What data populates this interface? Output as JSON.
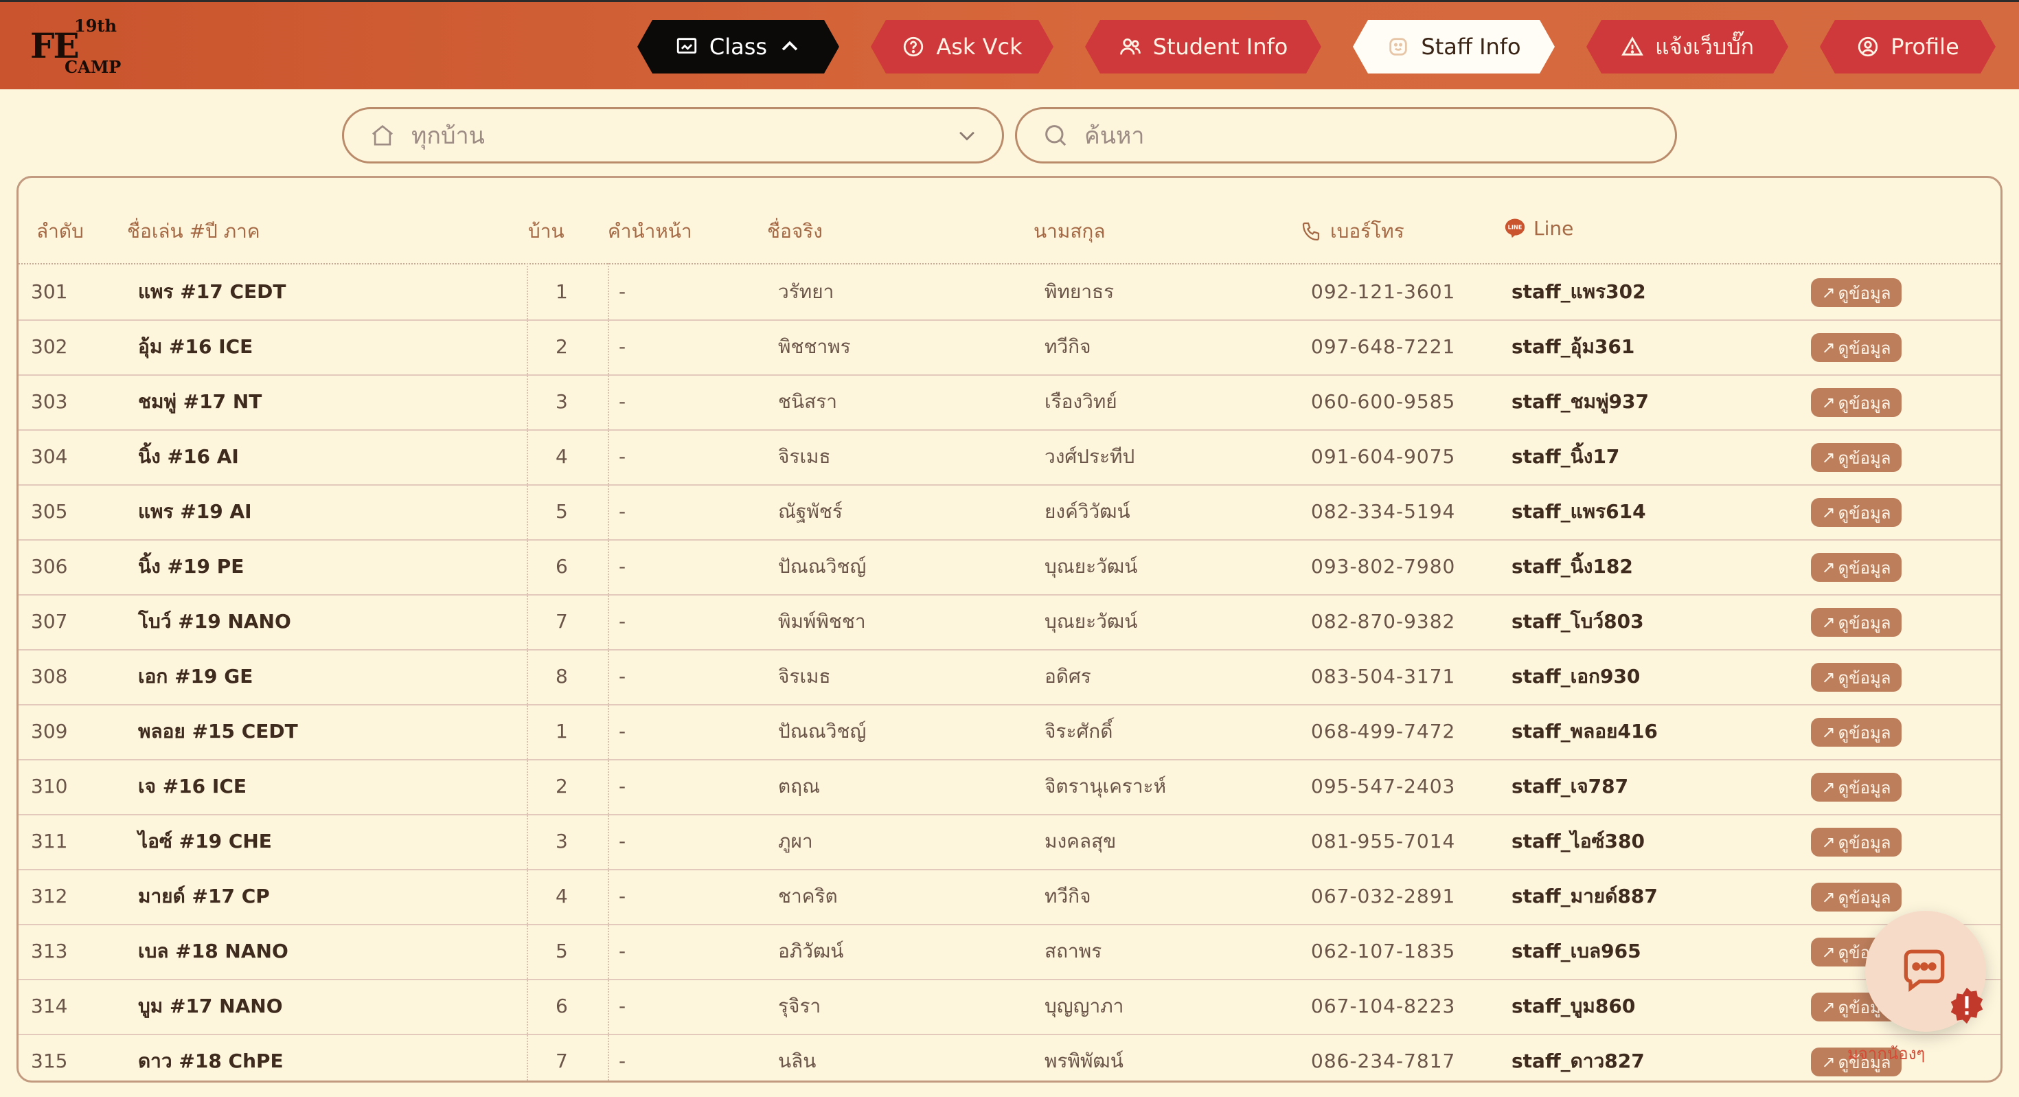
{
  "logo": {
    "main": "FE",
    "superscript": "19th",
    "sub": "CAMP"
  },
  "nav": [
    {
      "label": "Class",
      "icon": "presentation-icon",
      "style": "dark"
    },
    {
      "label": "Ask Vck",
      "icon": "question-icon",
      "style": "red"
    },
    {
      "label": "Student Info",
      "icon": "users-icon",
      "style": "red"
    },
    {
      "label": "Staff Info",
      "icon": "smiley-icon",
      "style": "active"
    },
    {
      "label": "แจ้งเว็บบั๊ก",
      "icon": "warning-icon",
      "style": "red"
    },
    {
      "label": "Profile",
      "icon": "user-circle-icon",
      "style": "red"
    }
  ],
  "filters": {
    "house_select": {
      "placeholder": "ทุกบ้าน"
    },
    "search": {
      "placeholder": "ค้นหา"
    }
  },
  "table": {
    "headers": {
      "index": "ลำดับ",
      "nickname": "ชื่อเล่น #ปี ภาค",
      "house": "บ้าน",
      "prefix": "คำนำหน้า",
      "firstname": "ชื่อจริง",
      "lastname": "นามสกุล",
      "phone": "เบอร์โทร",
      "line": "Line",
      "line_badge": "LINE"
    },
    "view_label": "ดูข้อมูล",
    "rows": [
      {
        "index": "301",
        "nickname": "แพร #17 CEDT",
        "house": "1",
        "prefix": "-",
        "firstname": "วรัทยา",
        "lastname": "พิทยาธร",
        "phone": "092-121-3601",
        "line": "staff_แพร302"
      },
      {
        "index": "302",
        "nickname": "อุ้ม #16 ICE",
        "house": "2",
        "prefix": "-",
        "firstname": "พิชชาพร",
        "lastname": "ทวีกิจ",
        "phone": "097-648-7221",
        "line": "staff_อุ้ม361"
      },
      {
        "index": "303",
        "nickname": "ชมพู่ #17 NT",
        "house": "3",
        "prefix": "-",
        "firstname": "ชนิสรา",
        "lastname": "เรืองวิทย์",
        "phone": "060-600-9585",
        "line": "staff_ชมพู่937"
      },
      {
        "index": "304",
        "nickname": "นิ้ง #16 AI",
        "house": "4",
        "prefix": "-",
        "firstname": "จิรเมธ",
        "lastname": "วงศ์ประทีป",
        "phone": "091-604-9075",
        "line": "staff_นิ้ง17"
      },
      {
        "index": "305",
        "nickname": "แพร #19 AI",
        "house": "5",
        "prefix": "-",
        "firstname": "ณัฐพัชร์",
        "lastname": "ยงค์วิวัฒน์",
        "phone": "082-334-5194",
        "line": "staff_แพร614"
      },
      {
        "index": "306",
        "nickname": "นิ้ง #19 PE",
        "house": "6",
        "prefix": "-",
        "firstname": "ปัณณวิชญ์",
        "lastname": "บุณยะวัฒน์",
        "phone": "093-802-7980",
        "line": "staff_นิ้ง182"
      },
      {
        "index": "307",
        "nickname": "โบว์ #19 NANO",
        "house": "7",
        "prefix": "-",
        "firstname": "พิมพ์พิชชา",
        "lastname": "บุณยะวัฒน์",
        "phone": "082-870-9382",
        "line": "staff_โบว์803"
      },
      {
        "index": "308",
        "nickname": "เอก #19 GE",
        "house": "8",
        "prefix": "-",
        "firstname": "จิรเมธ",
        "lastname": "อดิศร",
        "phone": "083-504-3171",
        "line": "staff_เอก930"
      },
      {
        "index": "309",
        "nickname": "พลอย #15 CEDT",
        "house": "1",
        "prefix": "-",
        "firstname": "ปัณณวิชญ์",
        "lastname": "จิระศักดิ์",
        "phone": "068-499-7472",
        "line": "staff_พลอย416"
      },
      {
        "index": "310",
        "nickname": "เจ #16 ICE",
        "house": "2",
        "prefix": "-",
        "firstname": "ตฤณ",
        "lastname": "จิตรานุเคราะห์",
        "phone": "095-547-2403",
        "line": "staff_เจ787"
      },
      {
        "index": "311",
        "nickname": "ไอซ์ #19 CHE",
        "house": "3",
        "prefix": "-",
        "firstname": "ภูผา",
        "lastname": "มงคลสุข",
        "phone": "081-955-7014",
        "line": "staff_ไอซ์380"
      },
      {
        "index": "312",
        "nickname": "มายด์ #17 CP",
        "house": "4",
        "prefix": "-",
        "firstname": "ชาคริต",
        "lastname": "ทวีกิจ",
        "phone": "067-032-2891",
        "line": "staff_มายด์887"
      },
      {
        "index": "313",
        "nickname": "เบล #18 NANO",
        "house": "5",
        "prefix": "-",
        "firstname": "อภิวัฒน์",
        "lastname": "สถาพร",
        "phone": "062-107-1835",
        "line": "staff_เบล965"
      },
      {
        "index": "314",
        "nickname": "บูม #17 NANO",
        "house": "6",
        "prefix": "-",
        "firstname": "รุจิรา",
        "lastname": "บุญญาภา",
        "phone": "067-104-8223",
        "line": "staff_บูม860"
      },
      {
        "index": "315",
        "nickname": "ดาว #18 ChPE",
        "house": "7",
        "prefix": "-",
        "firstname": "นลิน",
        "lastname": "พรพิพัฒน์",
        "phone": "086-234-7817",
        "line": "staff_ดาว827"
      }
    ]
  },
  "chat_widget": {
    "label": "มจากน้องๆ"
  },
  "colors": {
    "header_bg": "#d46a40",
    "tab_red": "#d0393b",
    "tab_dark": "#0c0a09",
    "tab_active": "#fffdf6",
    "page_bg": "#fdf5dc",
    "view_button": "#bd7e5c",
    "line_green": "#c9542d"
  }
}
